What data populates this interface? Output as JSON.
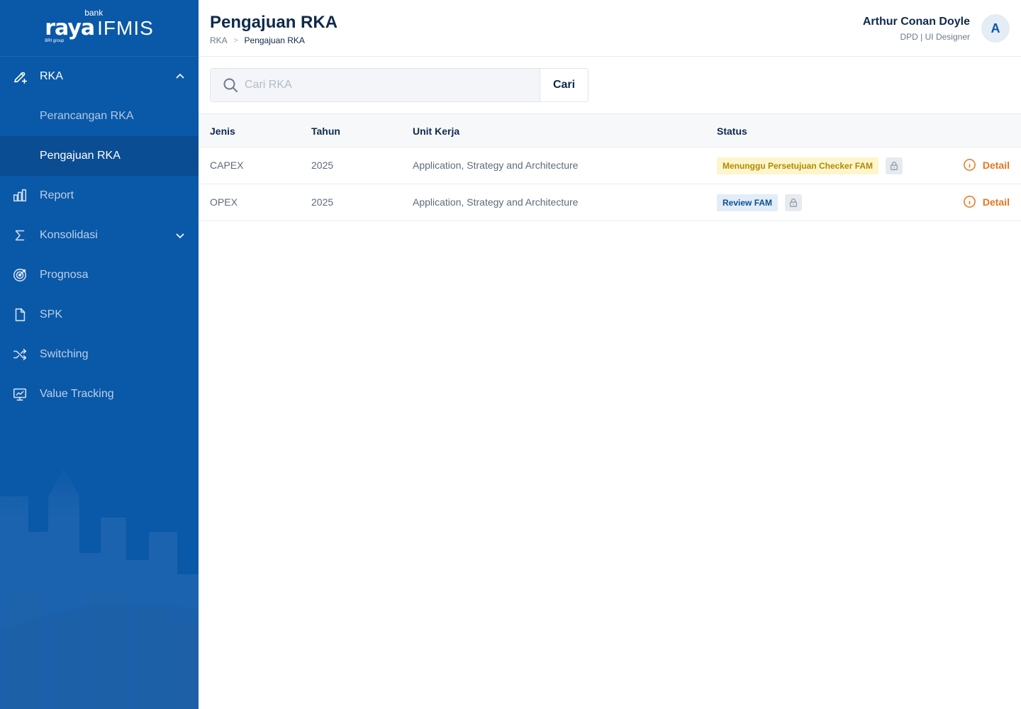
{
  "brand": {
    "bank": "bank",
    "name": "raya",
    "group": "BRI group",
    "product": "IFMIS"
  },
  "sidebar": {
    "items": [
      {
        "label": "RKA",
        "icon": "edit-plus-icon",
        "expanded": true,
        "children": [
          {
            "label": "Perancangan RKA",
            "active": false
          },
          {
            "label": "Pengajuan RKA",
            "active": true
          }
        ]
      },
      {
        "label": "Report",
        "icon": "bar-chart-icon"
      },
      {
        "label": "Konsolidasi",
        "icon": "sigma-icon",
        "expanded": false
      },
      {
        "label": "Prognosa",
        "icon": "target-icon"
      },
      {
        "label": "SPK",
        "icon": "file-icon"
      },
      {
        "label": "Switching",
        "icon": "shuffle-icon"
      },
      {
        "label": "Value Tracking",
        "icon": "monitor-chart-icon"
      }
    ]
  },
  "header": {
    "title": "Pengajuan RKA",
    "breadcrumb": {
      "root": "RKA",
      "separator": ">",
      "current": "Pengajuan RKA"
    },
    "user": {
      "name": "Arthur Conan Doyle",
      "role": "DPD | UI Designer",
      "avatar_initial": "A"
    }
  },
  "search": {
    "placeholder": "Cari RKA",
    "value": "",
    "button_label": "Cari"
  },
  "table": {
    "columns": [
      "Jenis",
      "Tahun",
      "Unit Kerja",
      "Status"
    ],
    "rows": [
      {
        "jenis": "CAPEX",
        "tahun": "2025",
        "unit_kerja": "Application, Strategy and Architecture",
        "status": "Menunggu Persetujuan Checker FAM",
        "status_color": "#fdf5cc",
        "action": "Detail"
      },
      {
        "jenis": "OPEX",
        "tahun": "2025",
        "unit_kerja": "Application, Strategy and Architecture",
        "status": "Review FAM",
        "status_color": "#e3edf7",
        "action": "Detail"
      }
    ]
  },
  "colors": {
    "sidebar_bg": "#0a58a8",
    "sidebar_active": "#0b4d93",
    "action_orange": "#e4761b",
    "text_dark": "#0f2a4a"
  }
}
